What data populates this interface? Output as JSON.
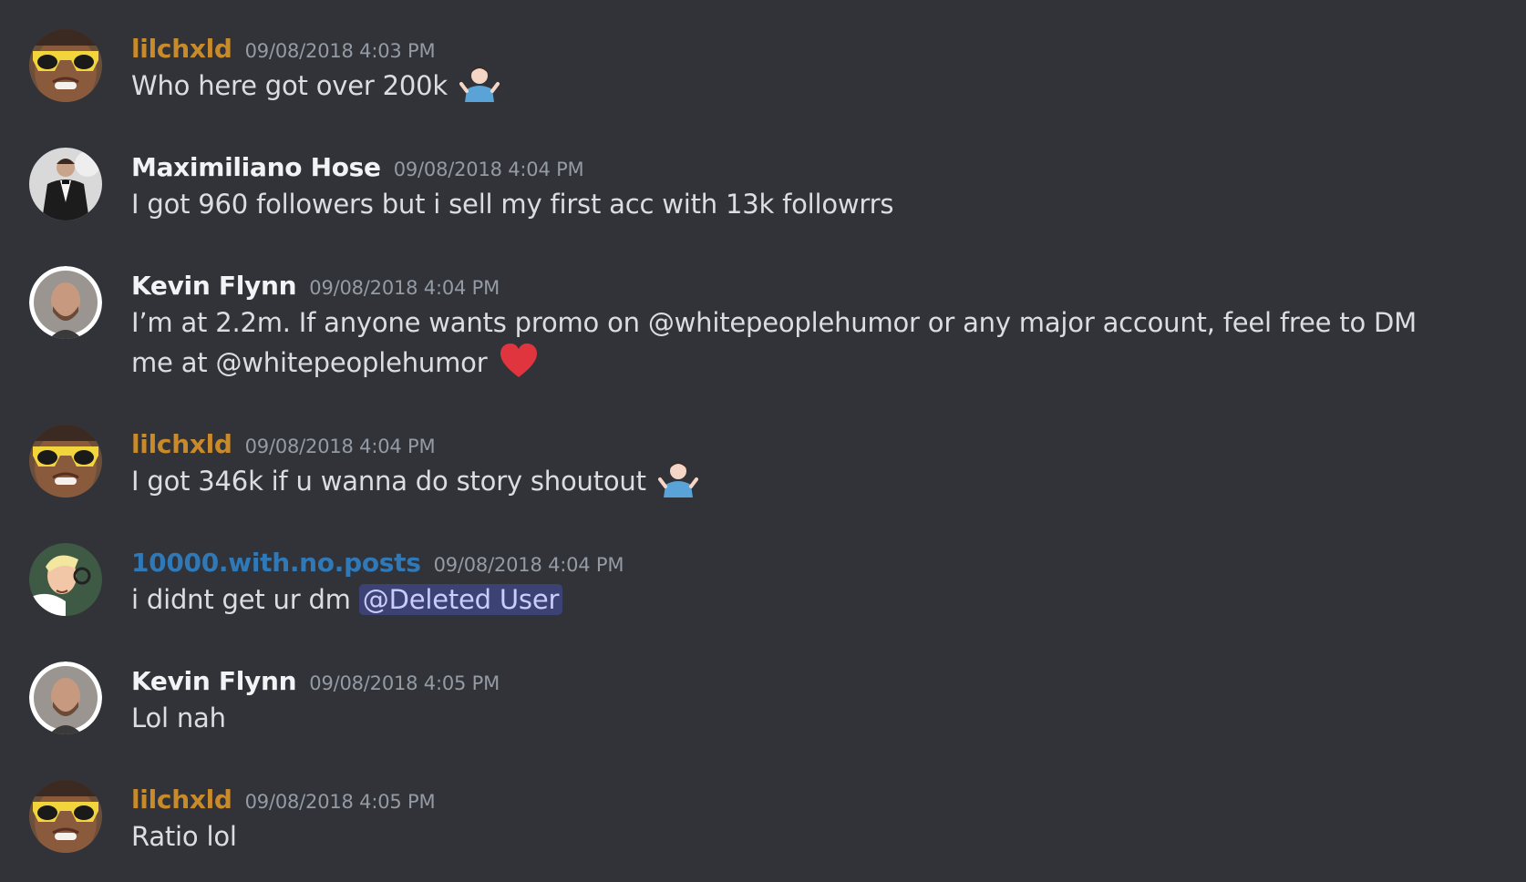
{
  "colors": {
    "background": "#313338",
    "text": "#dbdee1",
    "timestamp": "#949ba4",
    "mention_bg": "#4a4f8a",
    "mention_text": "#c9cdfb"
  },
  "messages": [
    {
      "username": "lilchxld",
      "username_color": "#c98a2a",
      "avatar": "sunglasses-avatar",
      "timestamp": "09/08/2018 4:03 PM",
      "text": "Who here got over 200k",
      "emoji": "person-shrugging-emoji"
    },
    {
      "username": "Maximiliano Hose",
      "username_color": "#f2f3f5",
      "avatar": "tuxedo-man-avatar",
      "timestamp": "09/08/2018 4:04 PM",
      "text": "I got 960 followers but i sell my first acc with 13k followrrs"
    },
    {
      "username": "Kevin Flynn",
      "username_color": "#f2f3f5",
      "avatar": "bald-man-avatar",
      "timestamp": "09/08/2018 4:04 PM",
      "text": "I’m at 2.2m. If anyone wants promo on @whitepeoplehumor or any major account, feel free to DM me at @whitepeoplehumor",
      "emoji": "red-heart-emoji"
    },
    {
      "username": "lilchxld",
      "username_color": "#c98a2a",
      "avatar": "sunglasses-avatar",
      "timestamp": "09/08/2018 4:04 PM",
      "text": "I got 346k if u wanna do story shoutout",
      "emoji": "person-shrugging-emoji"
    },
    {
      "username": "10000.with.no.posts",
      "username_color": "#2f79b8",
      "avatar": "cartoon-avatar",
      "timestamp": "09/08/2018 4:04 PM",
      "text": "i didnt get ur dm",
      "mention": "@Deleted User"
    },
    {
      "username": "Kevin Flynn",
      "username_color": "#f2f3f5",
      "avatar": "bald-man-avatar",
      "timestamp": "09/08/2018 4:05 PM",
      "text": "Lol nah"
    },
    {
      "username": "lilchxld",
      "username_color": "#c98a2a",
      "avatar": "sunglasses-avatar",
      "timestamp": "09/08/2018 4:05 PM",
      "text": "Ratio lol"
    }
  ]
}
